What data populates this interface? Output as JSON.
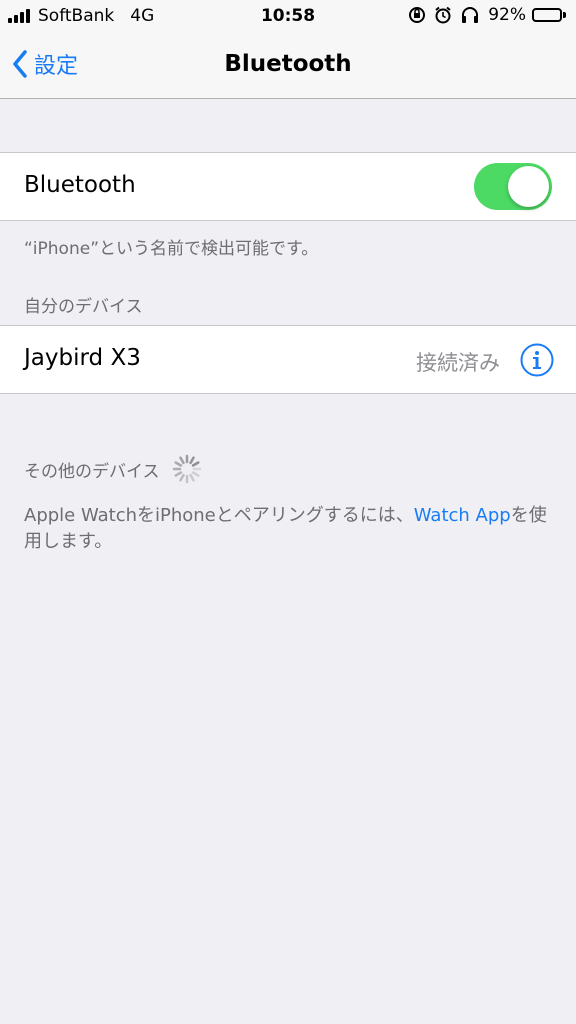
{
  "status_bar": {
    "carrier": "SoftBank",
    "network": "4G",
    "time": "10:58",
    "battery_percent": "92%",
    "battery_level": 0.92,
    "icons": [
      "signal-icon",
      "rotation-lock-icon",
      "alarm-icon",
      "headphones-icon",
      "battery-icon"
    ]
  },
  "nav": {
    "back_label": "設定",
    "title": "Bluetooth"
  },
  "bluetooth": {
    "label": "Bluetooth",
    "enabled": true,
    "discoverable_note": "“iPhone”という名前で検出可能です。"
  },
  "my_devices": {
    "header": "自分のデバイス",
    "devices": [
      {
        "name": "Jaybird X3",
        "status": "接続済み"
      }
    ]
  },
  "other_devices": {
    "header": "その他のデバイス",
    "note_prefix": "Apple WatchをiPhoneとペアリングするには、",
    "note_link": "Watch App",
    "note_suffix": "を使用します。"
  },
  "colors": {
    "accent": "#1a7cf5",
    "toggle_on": "#4cd964",
    "background": "#efeff4"
  }
}
